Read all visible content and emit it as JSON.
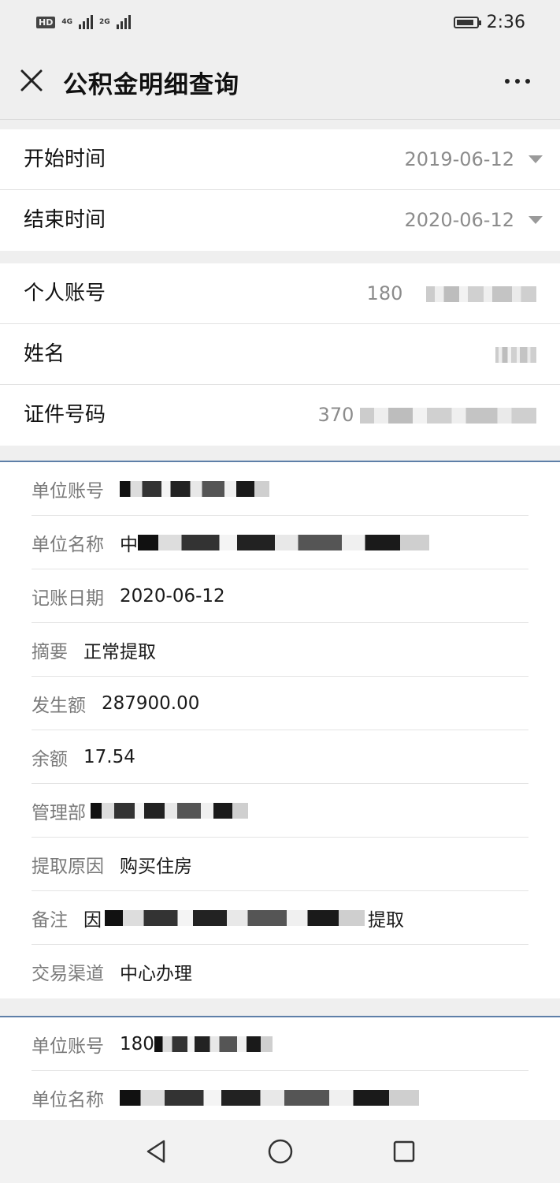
{
  "status_bar": {
    "network_badge": "HD",
    "net1": "4G",
    "net2": "2G",
    "time": "2:36",
    "battery_level": 0.9
  },
  "header": {
    "title": "公积金明细查询"
  },
  "query": {
    "start_label": "开始时间",
    "start_value": "2019-06-12",
    "end_label": "结束时间",
    "end_value": "2020-06-12"
  },
  "person": {
    "account_label": "个人账号",
    "account_value": "180",
    "name_label": "姓名",
    "id_label": "证件号码",
    "id_value": "370"
  },
  "record1": {
    "unit_account_label": "单位账号",
    "unit_name_label": "单位名称",
    "unit_name_prefix": "中",
    "date_label": "记账日期",
    "date_value": "2020-06-12",
    "summary_label": "摘要",
    "summary_value": "正常提取",
    "amount_label": "发生额",
    "amount_value": "287900.00",
    "balance_label": "余额",
    "balance_value": "17.54",
    "manager_label": "管理部",
    "reason_label": "提取原因",
    "reason_value": "购买住房",
    "remark_label": "备注",
    "remark_prefix": "因",
    "remark_suffix": "提取",
    "channel_label": "交易渠道",
    "channel_value": "中心办理"
  },
  "record2": {
    "unit_account_label": "单位账号",
    "unit_account_value": "180",
    "unit_name_label": "单位名称"
  }
}
